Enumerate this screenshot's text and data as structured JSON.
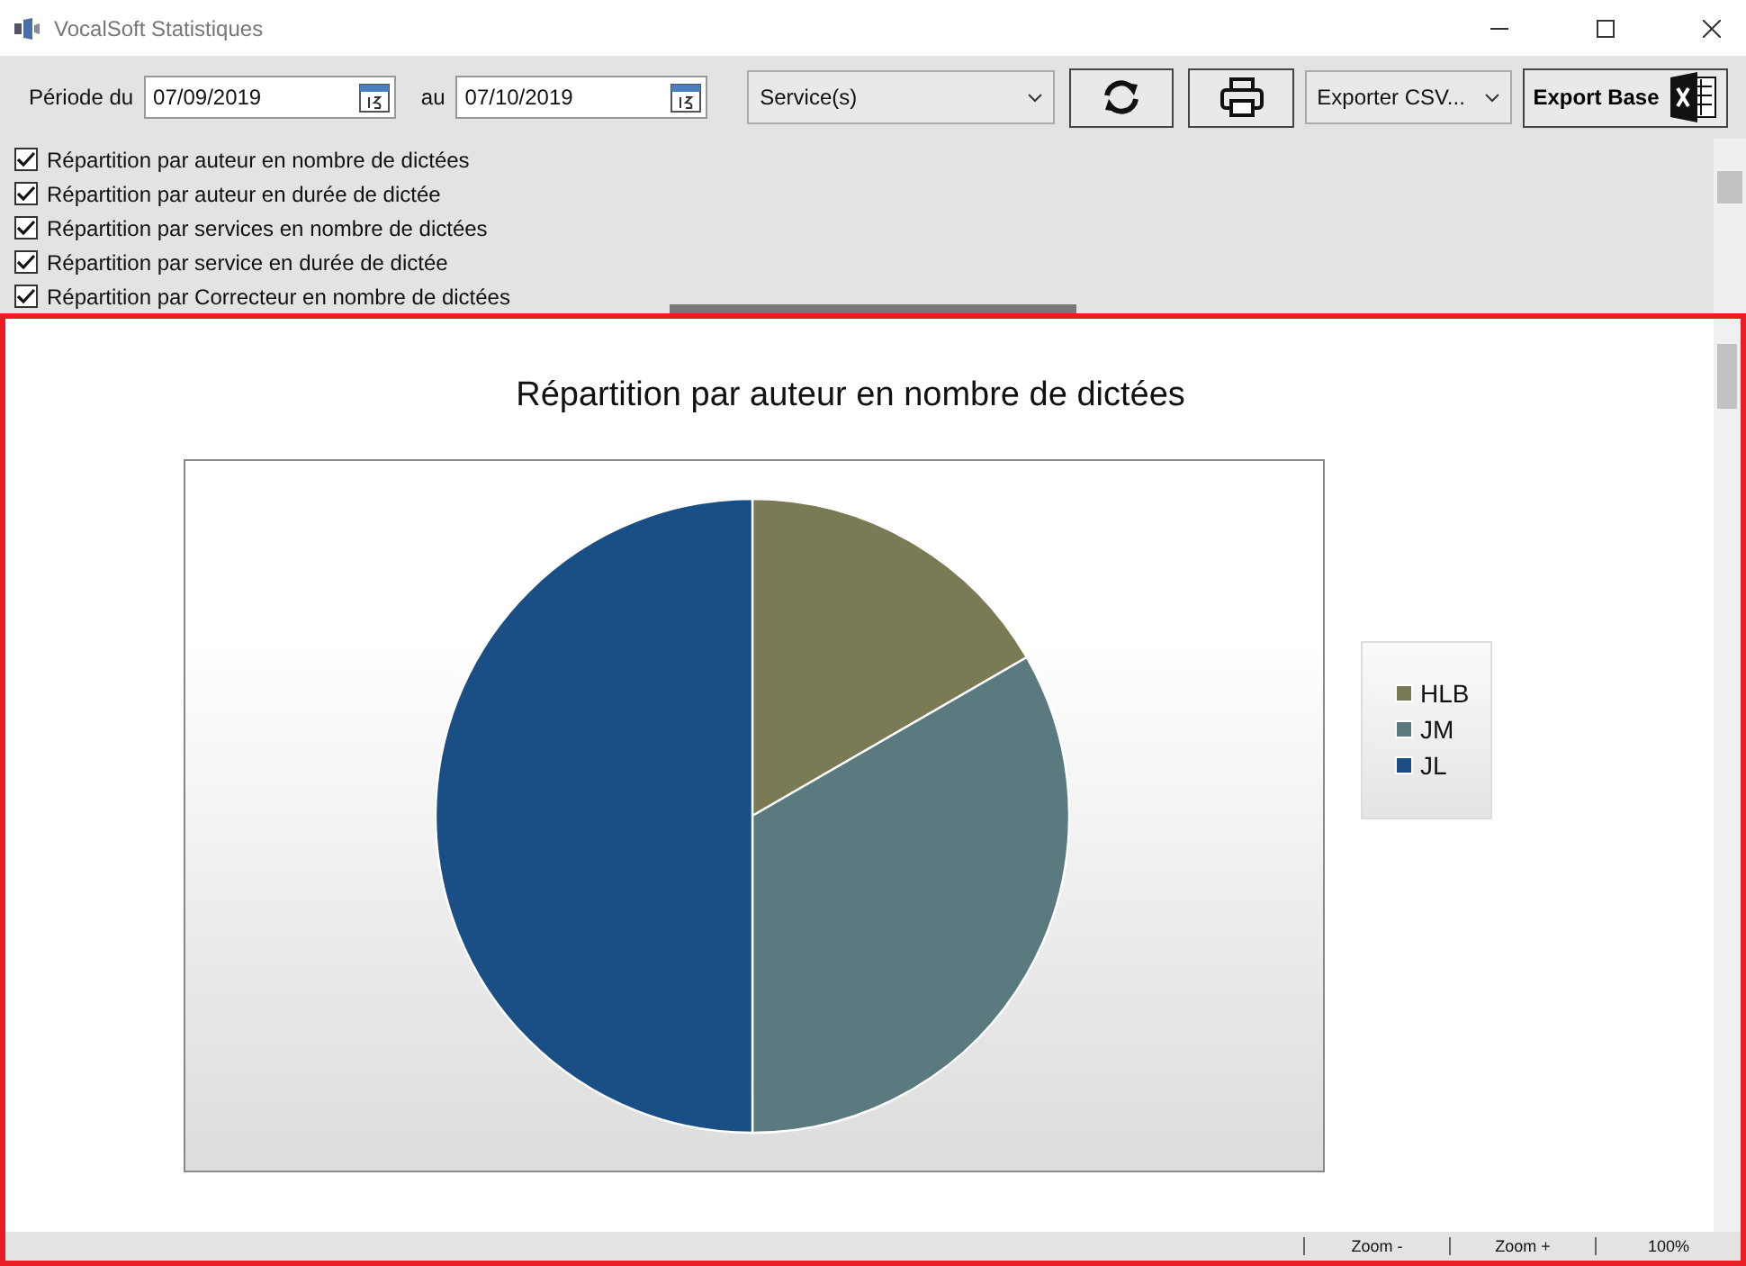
{
  "window": {
    "title": "VocalSoft Statistiques"
  },
  "toolbar": {
    "from_label": "Période du",
    "from_date": "07/09/2019",
    "to_label": "au",
    "to_date": "07/10/2019",
    "service": "Service(s)",
    "export_csv": "Exporter CSV...",
    "export_base": "Export Base"
  },
  "reports": [
    {
      "label": "Répartition par auteur en nombre de dictées",
      "checked": true
    },
    {
      "label": "Répartition par auteur en durée de dictée",
      "checked": true
    },
    {
      "label": "Répartition par services en nombre de dictées",
      "checked": true
    },
    {
      "label": "Répartition par service en durée de dictée",
      "checked": true
    },
    {
      "label": "Répartition par Correcteur en nombre de dictées",
      "checked": true
    }
  ],
  "chart": {
    "title": "Répartition par auteur en nombre de dictées",
    "legend": [
      {
        "name": "HLB",
        "color": "#7a7a55"
      },
      {
        "name": "JM",
        "color": "#5a7a80"
      },
      {
        "name": "JL",
        "color": "#1a4f85"
      }
    ]
  },
  "status_bar": {
    "zoom_out": "Zoom -",
    "zoom_in": "Zoom +",
    "zoom": "100%"
  }
}
